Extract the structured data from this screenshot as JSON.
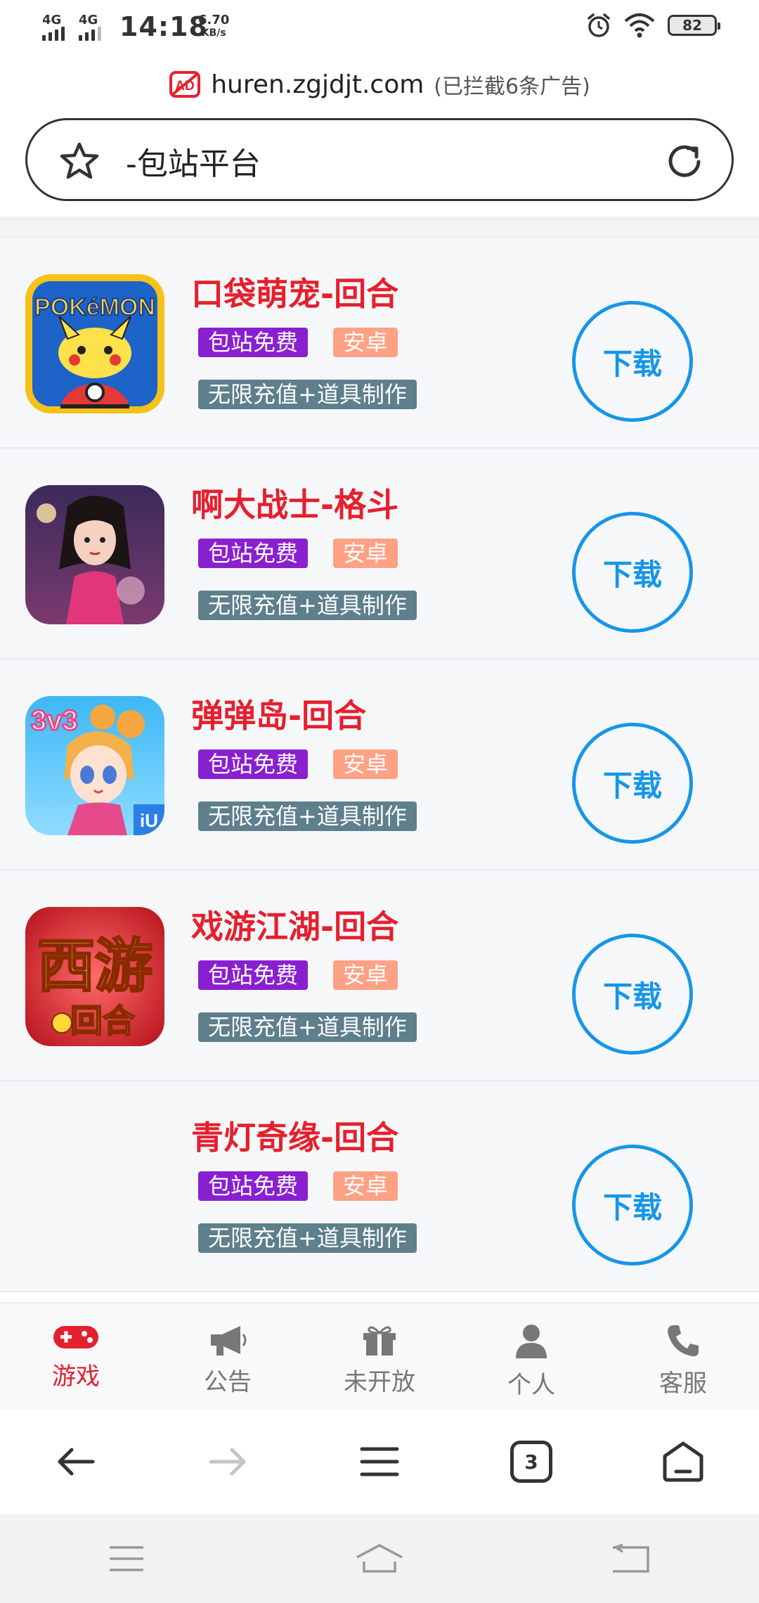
{
  "status_bar": {
    "network_1": "4G",
    "network_2": "4G",
    "time": "14:18",
    "speed_value": "6.70",
    "speed_unit": "KB/s",
    "battery": "82",
    "icons": [
      "alarm-icon",
      "wifi-icon",
      "battery-icon"
    ]
  },
  "url_bar": {
    "ad_badge": "AD",
    "domain": "huren.zgjdjt.com",
    "ad_note": "(已拦截6条广告)"
  },
  "search": {
    "query": "-包站平台"
  },
  "colors": {
    "title_red": "#e5202e",
    "tag_purple": "#8a1fd0",
    "tag_orange": "#ffa184",
    "tag_gray": "#5e7f8c",
    "accent_blue": "#1596e8"
  },
  "games": [
    {
      "title": "口袋萌宠-回合",
      "tag_free": "包站免费",
      "tag_platform": "安卓",
      "tag_feature": "无限充值+道具制作",
      "button": "下载",
      "icon_logo": "POKéMON"
    },
    {
      "title": "啊大战士-格斗",
      "tag_free": "包站免费",
      "tag_platform": "安卓",
      "tag_feature": "无限充值+道具制作",
      "button": "下载"
    },
    {
      "title": "弹弹岛-回合",
      "tag_free": "包站免费",
      "tag_platform": "安卓",
      "tag_feature": "无限充值+道具制作",
      "button": "下载",
      "icon_logo": "3v3",
      "icon_badge": "iU"
    },
    {
      "title": "戏游江湖-回合",
      "tag_free": "包站免费",
      "tag_platform": "安卓",
      "tag_feature": "无限充值+道具制作",
      "button": "下载",
      "icon_logo": "西游",
      "icon_logo_2": "回合"
    },
    {
      "title": "青灯奇缘-回合",
      "tag_free": "包站免费",
      "tag_platform": "安卓",
      "tag_feature": "无限充值+道具制作",
      "button": "下载"
    }
  ],
  "tabs": [
    {
      "label": "游戏",
      "icon": "gamepad-icon",
      "active": true
    },
    {
      "label": "公告",
      "icon": "megaphone-icon",
      "active": false
    },
    {
      "label": "未开放",
      "icon": "gift-icon",
      "active": false
    },
    {
      "label": "个人",
      "icon": "person-icon",
      "active": false
    },
    {
      "label": "客服",
      "icon": "phone-icon",
      "active": false
    }
  ],
  "browser_nav": {
    "tab_count": "3"
  }
}
